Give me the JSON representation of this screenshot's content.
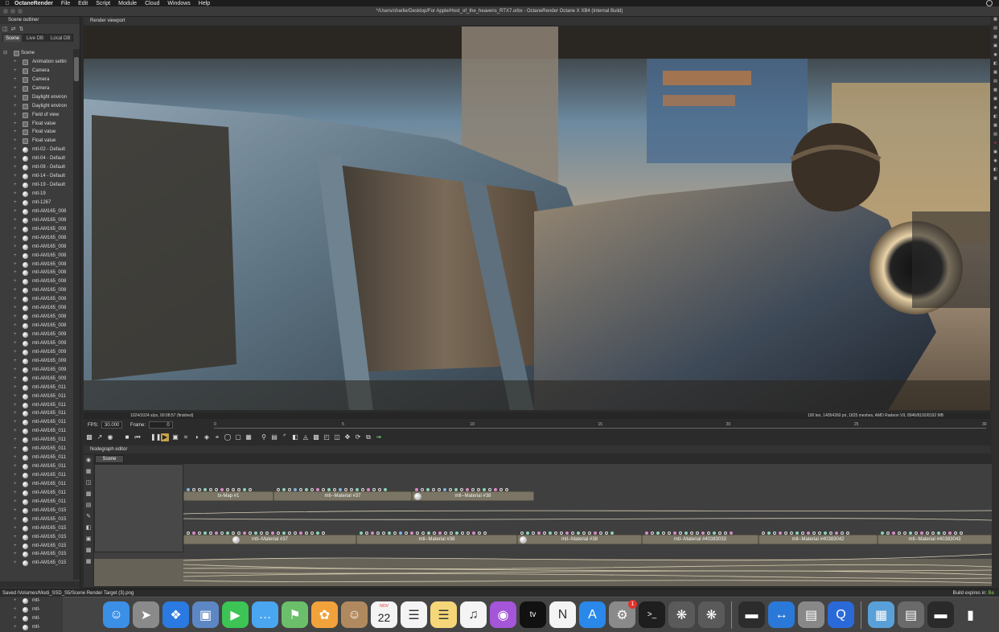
{
  "menubar": {
    "app_name": "OctaneRender",
    "items": [
      "File",
      "Edit",
      "Script",
      "Module",
      "Cloud",
      "Windows",
      "Help"
    ]
  },
  "window": {
    "title": "*/Users/charlie/Desktop/For Apple/Host_of_the_heavens_RTX7.orbx - OctaneRender Octane X XB4 (Internal Build)"
  },
  "outliner": {
    "title": "Scene outliner",
    "tabs": [
      "Scene",
      "Live DB",
      "Local DB"
    ],
    "root": "Scene",
    "items": [
      {
        "label": "Animation settin",
        "icon": "settings"
      },
      {
        "label": "Camera",
        "icon": "camera"
      },
      {
        "label": "Camera",
        "icon": "camera"
      },
      {
        "label": "Camera",
        "icon": "camera"
      },
      {
        "label": "Daylight environ",
        "icon": "environment"
      },
      {
        "label": "Daylight environ",
        "icon": "environment"
      },
      {
        "label": "Field of view",
        "icon": "value"
      },
      {
        "label": "Float value",
        "icon": "value"
      },
      {
        "label": "Float value",
        "icon": "value"
      },
      {
        "label": "Float value",
        "icon": "value"
      },
      {
        "label": "mtl-02 - Default",
        "icon": "material"
      },
      {
        "label": "mtl-04 - Default",
        "icon": "material"
      },
      {
        "label": "mtl-08 - Default",
        "icon": "material"
      },
      {
        "label": "mtl-14 - Default",
        "icon": "material"
      },
      {
        "label": "mtl-19 - Default",
        "icon": "material"
      },
      {
        "label": "mtl-19",
        "icon": "material"
      },
      {
        "label": "mtl-1267",
        "icon": "material"
      },
      {
        "label": "mtl-AM165_008",
        "icon": "material"
      },
      {
        "label": "mtl-AM165_008",
        "icon": "material"
      },
      {
        "label": "mtl-AM165_008",
        "icon": "material"
      },
      {
        "label": "mtl-AM165_008",
        "icon": "material"
      },
      {
        "label": "mtl-AM165_008",
        "icon": "material"
      },
      {
        "label": "mtl-AM165_008",
        "icon": "material"
      },
      {
        "label": "mtl-AM165_008",
        "icon": "material"
      },
      {
        "label": "mtl-AM165_008",
        "icon": "material"
      },
      {
        "label": "mtl-AM165_008",
        "icon": "material"
      },
      {
        "label": "mtl-AM165_008",
        "icon": "material"
      },
      {
        "label": "mtl-AM165_008",
        "icon": "material"
      },
      {
        "label": "mtl-AM165_008",
        "icon": "material"
      },
      {
        "label": "mtl-AM165_008",
        "icon": "material"
      },
      {
        "label": "mtl-AM165_008",
        "icon": "material"
      },
      {
        "label": "mtl-AM165_009",
        "icon": "material"
      },
      {
        "label": "mtl-AM165_009",
        "icon": "material"
      },
      {
        "label": "mtl-AM165_009",
        "icon": "material"
      },
      {
        "label": "mtl-AM165_009",
        "icon": "material"
      },
      {
        "label": "mtl-AM165_009",
        "icon": "material"
      },
      {
        "label": "mtl-AM165_009",
        "icon": "material"
      },
      {
        "label": "mtl-AM165_011",
        "icon": "material"
      },
      {
        "label": "mtl-AM165_011",
        "icon": "material"
      },
      {
        "label": "mtl-AM165_011",
        "icon": "material"
      },
      {
        "label": "mtl-AM165_011",
        "icon": "material"
      },
      {
        "label": "mtl-AM165_011",
        "icon": "material"
      },
      {
        "label": "mtl-AM165_011",
        "icon": "material"
      },
      {
        "label": "mtl-AM165_011",
        "icon": "material"
      },
      {
        "label": "mtl-AM165_011",
        "icon": "material"
      },
      {
        "label": "mtl-AM165_011",
        "icon": "material"
      },
      {
        "label": "mtl-AM165_011",
        "icon": "material"
      },
      {
        "label": "mtl-AM165_011",
        "icon": "material"
      },
      {
        "label": "mtl-AM165_011",
        "icon": "material"
      },
      {
        "label": "mtl-AM165_011",
        "icon": "material"
      },
      {
        "label": "mtl-AM165_011",
        "icon": "material"
      },
      {
        "label": "mtl-AM165_015",
        "icon": "material"
      },
      {
        "label": "mtl-AM165_015",
        "icon": "material"
      },
      {
        "label": "mtl-AM165_015",
        "icon": "material"
      },
      {
        "label": "mtl-AM165_015",
        "icon": "material"
      },
      {
        "label": "mtl-AM165_015",
        "icon": "material"
      },
      {
        "label": "mtl-AM165_015",
        "icon": "material"
      },
      {
        "label": "mtl-AM165_015",
        "icon": "material"
      }
    ],
    "below_dock": [
      "mtl-",
      "mtl-",
      "mtl-",
      "mtl-"
    ]
  },
  "viewport": {
    "title": "Render viewport",
    "status_left": "1024/1024 s/px, 00:08:57 (finished)",
    "status_right": "100 tex, 14054260 pri, 1825 meshes, AMD Radeon VII, 8946/8192/8192 MB"
  },
  "playback": {
    "fps_label": "FPS:",
    "fps_value": "30.000",
    "frame_label": "Frame:",
    "frame_value": "0",
    "timeline_ticks": [
      "0",
      "5",
      "10",
      "15",
      "20",
      "25",
      "30"
    ]
  },
  "nodegraph": {
    "title": "Nodegraph editor",
    "tab": "Scene",
    "nodes_top": [
      "tx-Map #1",
      "mtl--Material #37",
      "mtl--Material #38"
    ],
    "nodes_bottom": [
      "mtl--Material #37",
      "mtl--Material #38",
      "mtl--Material #38",
      "mtl--Material #40383033",
      "mtl--Material #40383042",
      "mtl--Material #40383043"
    ]
  },
  "statusbar": {
    "message": "Saved /Volumes/Modi_SSD_S5/Scene Render Target (3).png",
    "build_label": "Build expires in:",
    "build_value": "Be"
  },
  "dock": {
    "calendar_month": "NOV",
    "calendar_day": "22",
    "settings_badge": "1",
    "apps": [
      {
        "name": "finder",
        "icon": "finder-icon",
        "color": "#3b8fe6"
      },
      {
        "name": "launchpad",
        "icon": "rocket-icon",
        "color": "#8a8a8a"
      },
      {
        "name": "safari",
        "icon": "compass-icon",
        "color": "#2a7ae2"
      },
      {
        "name": "preview",
        "icon": "photo-icon",
        "color": "#5d87c4"
      },
      {
        "name": "facetime",
        "icon": "video-icon",
        "color": "#3cc454"
      },
      {
        "name": "messages",
        "icon": "chat-icon",
        "color": "#4aa6f0"
      },
      {
        "name": "maps",
        "icon": "map-icon",
        "color": "#6bbf6b"
      },
      {
        "name": "photos",
        "icon": "flower-icon",
        "color": "#f2a23a"
      },
      {
        "name": "contacts",
        "icon": "contacts-icon",
        "color": "#b08a5e"
      },
      {
        "name": "calendar",
        "icon": "calendar-icon",
        "color": "#f4f4f4"
      },
      {
        "name": "reminders",
        "icon": "list-icon",
        "color": "#f4f4f4"
      },
      {
        "name": "notes",
        "icon": "notes-icon",
        "color": "#f5d77a"
      },
      {
        "name": "music",
        "icon": "music-icon",
        "color": "#f4f4f4"
      },
      {
        "name": "podcasts",
        "icon": "podcast-icon",
        "color": "#a455d8"
      },
      {
        "name": "tv",
        "icon": "tv-icon",
        "color": "#111111"
      },
      {
        "name": "news",
        "icon": "news-icon",
        "color": "#f4f4f4"
      },
      {
        "name": "app-store",
        "icon": "appstore-icon",
        "color": "#2a88ea"
      },
      {
        "name": "system-preferences",
        "icon": "gear-icon",
        "color": "#8a8a8a"
      },
      {
        "name": "terminal",
        "icon": "terminal-icon",
        "color": "#1e1e1e"
      },
      {
        "name": "octane",
        "icon": "octane-icon",
        "color": "#5a5a5a"
      },
      {
        "name": "octane-2",
        "icon": "octane-icon",
        "color": "#5a5a5a"
      }
    ],
    "apps_right": [
      {
        "name": "activity-monitor",
        "icon": "activity-icon",
        "color": "#2c2c2c"
      },
      {
        "name": "teamviewer",
        "icon": "teamviewer-icon",
        "color": "#2a78d8"
      },
      {
        "name": "preview-2",
        "icon": "preview-icon",
        "color": "#888888"
      },
      {
        "name": "quicktime",
        "icon": "quicktime-icon",
        "color": "#2a6ad8"
      }
    ],
    "apps_far_right": [
      {
        "name": "folder",
        "icon": "folder-icon",
        "color": "#5aa0d8"
      },
      {
        "name": "screens",
        "icon": "window-icon",
        "color": "#6a6a6a"
      },
      {
        "name": "console",
        "icon": "console-icon",
        "color": "#2a2a2a"
      },
      {
        "name": "trash",
        "icon": "trash-icon",
        "color": "#444444"
      }
    ]
  },
  "colors": {
    "accent_play": "#c8a24a",
    "node_fill": "#7a7564",
    "build_value": "#8fd14f"
  }
}
